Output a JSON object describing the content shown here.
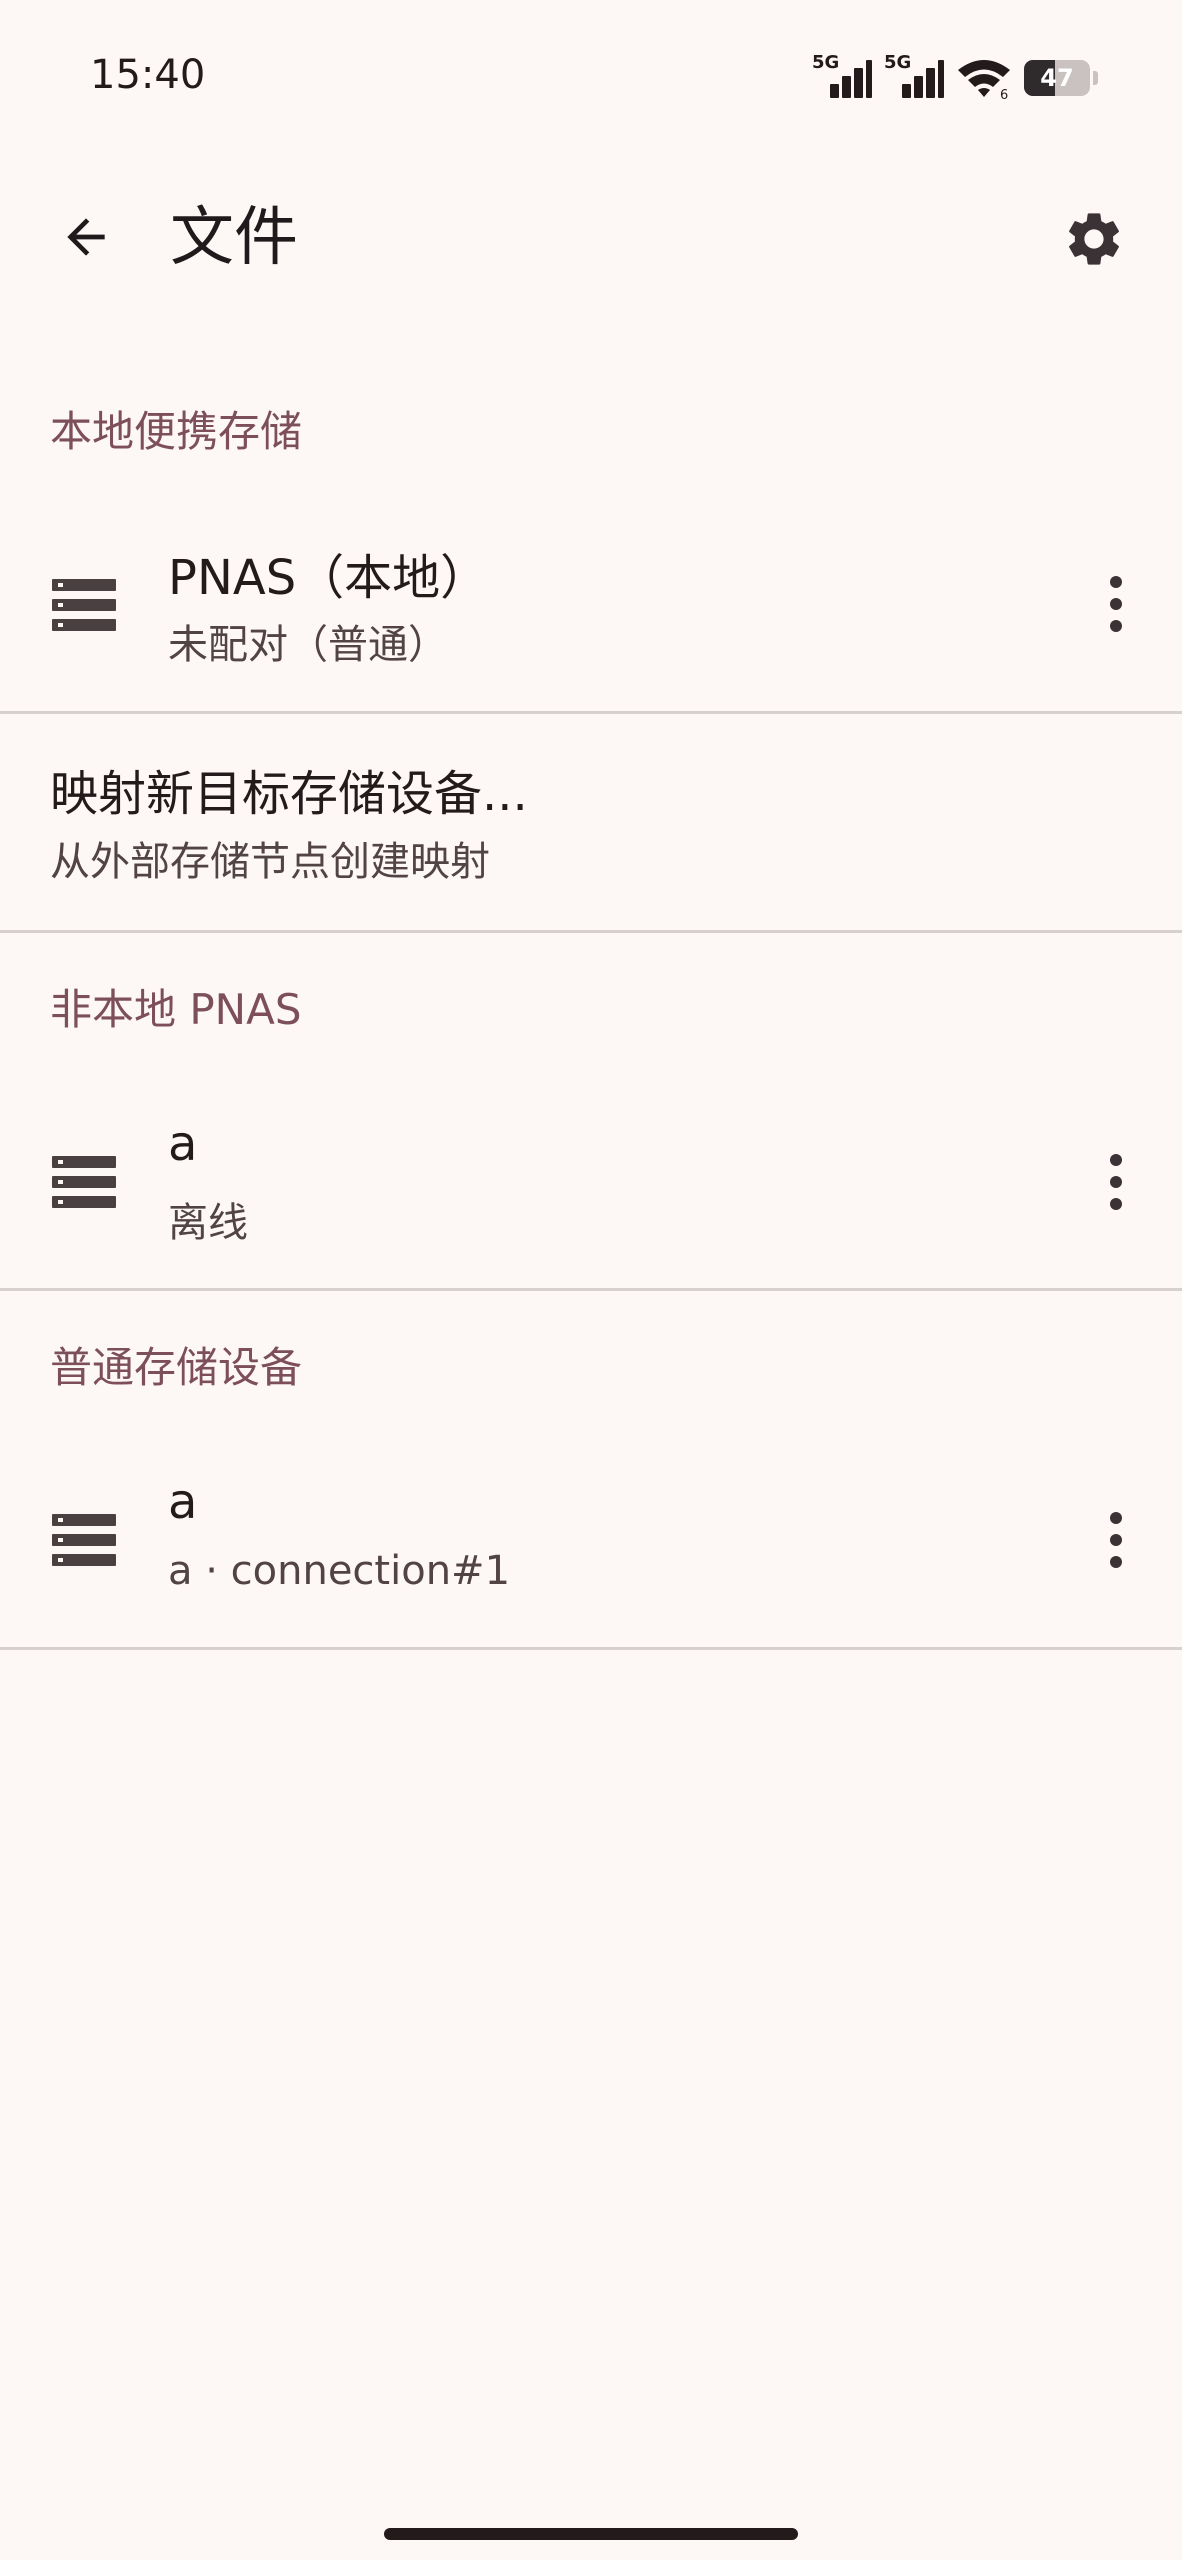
{
  "status_bar": {
    "time": "15:40",
    "signal1_label": "5G",
    "signal2_label": "5G",
    "wifi_icon": "wifi-6-icon",
    "battery_level": 47,
    "battery_text": "47"
  },
  "app_bar": {
    "back_icon": "arrow-back-icon",
    "title": "文件",
    "settings_icon": "gear-icon"
  },
  "sections": {
    "local": {
      "header": "本地便携存储",
      "item": {
        "icon": "storage-icon",
        "title": "PNAS（本地）",
        "subtitle": "未配对（普通）",
        "more_icon": "more-vert-icon"
      }
    },
    "map_new": {
      "title": "映射新目标存储设备...",
      "subtitle": "从外部存储节点创建映射"
    },
    "remote": {
      "header": "非本地 PNAS",
      "item": {
        "icon": "storage-icon",
        "title": "a",
        "subtitle": "离线",
        "more_icon": "more-vert-icon"
      }
    },
    "normal": {
      "header": "普通存储设备",
      "item": {
        "icon": "storage-icon",
        "title": "a",
        "subtitle": "a · connection#1",
        "more_icon": "more-vert-icon"
      }
    }
  },
  "colors": {
    "background": "#fdf8f6",
    "section_header": "#7d4f5a",
    "text_primary": "#231a1c",
    "text_secondary": "#524345",
    "divider": "#d7cfd0"
  }
}
